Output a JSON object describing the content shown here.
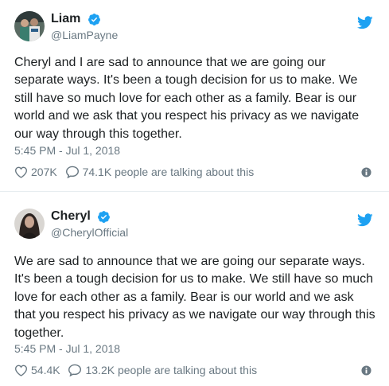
{
  "tweets": [
    {
      "display_name": "Liam",
      "handle": "@LiamPayne",
      "text": "Cheryl and I are sad to announce that we are going our\nseparate ways. It's been a tough decision for us to make. We\nstill have so much love for each other as a family. Bear is our\nworld and we ask that you respect his privacy as we navigate\nour way through this together.",
      "timestamp": "5:45 PM - Jul 1, 2018",
      "likes": "207K",
      "talking": "74.1K people are talking about this",
      "avatar_icon": "avatar-photo-liam",
      "verified_icon": "verified-badge-icon"
    },
    {
      "display_name": "Cheryl",
      "handle": "@CherylOfficial",
      "text": "We are sad to announce that we are going our separate ways.\nIt's been a tough decision for us to make. We still have so much\nlove for each other as a family.  Bear is our world and we ask\nthat you respect his privacy as we navigate our way through this\ntogether.",
      "timestamp": "5:45 PM - Jul 1, 2018",
      "likes": "54.4K",
      "talking": "13.2K people are talking about this",
      "avatar_icon": "avatar-photo-cheryl",
      "verified_icon": "verified-badge-icon"
    }
  ],
  "colors": {
    "twitter_blue": "#1da1f2",
    "secondary_text": "#697882",
    "primary_text": "#1c2022",
    "divider": "#e6ecf0"
  }
}
